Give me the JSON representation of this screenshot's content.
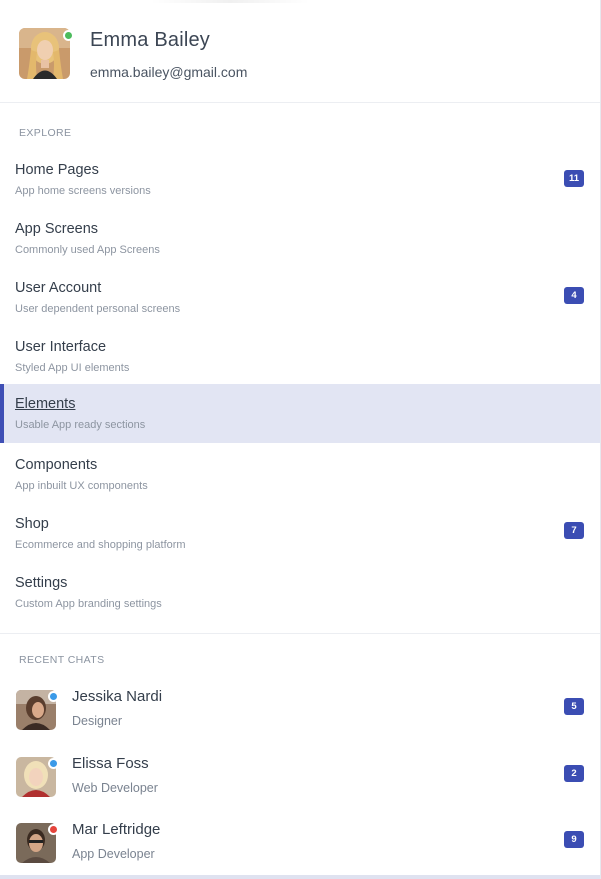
{
  "profile": {
    "name": "Emma Bailey",
    "email": "emma.bailey@gmail.com",
    "status_color": "#4cbb5c"
  },
  "explore": {
    "title": "EXPLORE",
    "items": [
      {
        "label": "Home Pages",
        "desc": "App home screens versions",
        "badge": "11"
      },
      {
        "label": "App Screens",
        "desc": "Commonly used App Screens",
        "badge": ""
      },
      {
        "label": "User Account",
        "desc": "User dependent personal screens",
        "badge": "4"
      },
      {
        "label": "User Interface",
        "desc": "Styled App UI elements",
        "badge": ""
      },
      {
        "label": "Elements",
        "desc": "Usable App ready sections",
        "badge": "",
        "active": true
      },
      {
        "label": "Components",
        "desc": "App inbuilt UX components",
        "badge": ""
      },
      {
        "label": "Shop",
        "desc": "Ecommerce and shopping platform",
        "badge": "7"
      },
      {
        "label": "Settings",
        "desc": "Custom App branding settings",
        "badge": ""
      }
    ]
  },
  "recent_chats": {
    "title": "RECENT CHATS",
    "items": [
      {
        "name": "Jessika Nardi",
        "role": "Designer",
        "badge": "5",
        "status_color": "#3b9ae8"
      },
      {
        "name": "Elissa Foss",
        "role": "Web Developer",
        "badge": "2",
        "status_color": "#3b9ae8"
      },
      {
        "name": "Mar Leftridge",
        "role": "App Developer",
        "badge": "9",
        "status_color": "#e5443b"
      }
    ]
  },
  "colors": {
    "accent": "#3b4db3",
    "active_bg": "#e2e5f3"
  }
}
